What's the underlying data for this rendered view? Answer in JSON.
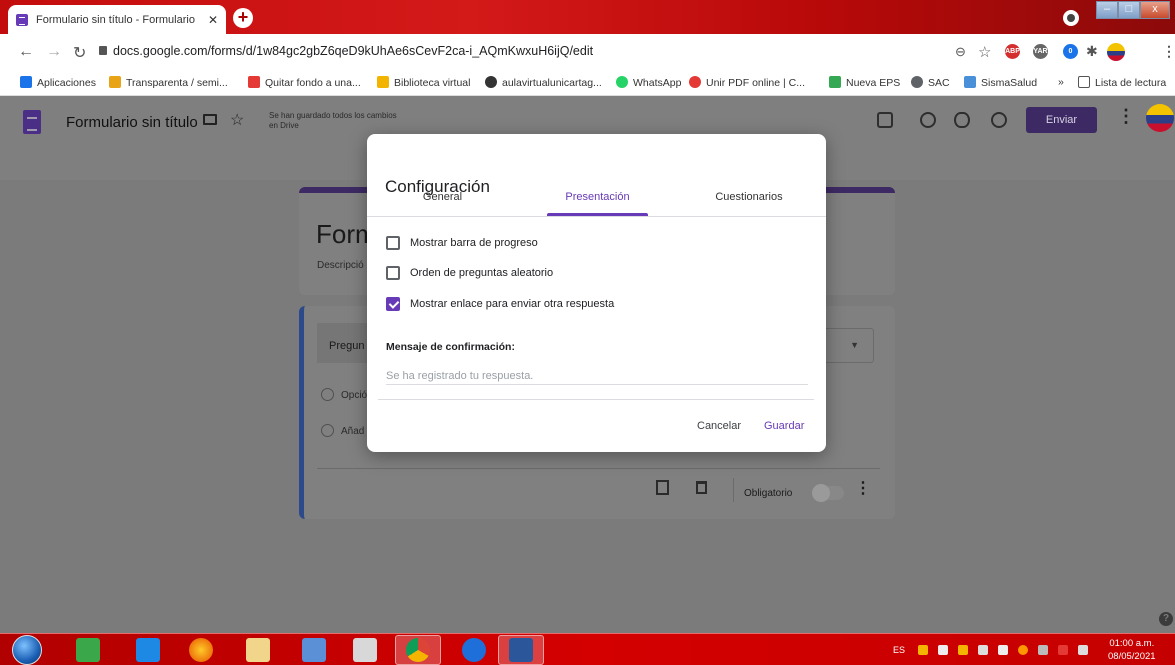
{
  "browser": {
    "tab_title": "Formulario sin título - Formulario",
    "tab_close": "✕",
    "new_tab": "+",
    "url": "docs.google.com/forms/d/1w84gc2gbZ6qeD9kUhAe6sCevF2ca-i_AQmKwxuH6ijQ/edit",
    "window_controls": {
      "minimize": "–",
      "maximize": "□",
      "close": "x"
    },
    "extensions": [
      "ABP",
      "YAR",
      "0"
    ]
  },
  "bookmarks": [
    {
      "label": "Aplicaciones",
      "color": "#1a73e8"
    },
    {
      "label": "Transparenta / semi...",
      "color": "#e8a317"
    },
    {
      "label": "Quitar fondo a una...",
      "color": "#e53935"
    },
    {
      "label": "Biblioteca virtual",
      "color": "#f2b400"
    },
    {
      "label": "aulavirtualunicartag...",
      "color": "#333333"
    },
    {
      "label": "WhatsApp",
      "color": "#25d366"
    },
    {
      "label": "Unir PDF online | C...",
      "color": "#e53935"
    },
    {
      "label": "Nueva EPS",
      "color": "#34a853"
    },
    {
      "label": "SAC",
      "color": "#5f6368"
    },
    {
      "label": "SismaSalud",
      "color": "#4a90d9"
    }
  ],
  "bookmarks_more": "»",
  "reading_list": "Lista de lectura",
  "forms_header": {
    "title": "Formulario sin título",
    "saved_status": "Se han guardado todos los cambios en Drive",
    "send_button": "Enviar"
  },
  "form": {
    "title_partial": "Form",
    "description_partial": "Descripció",
    "question_partial": "Pregun",
    "option_partial": "Opció",
    "add_option_partial": "Añad",
    "required_label": "Obligatorio"
  },
  "dialog": {
    "title": "Configuración",
    "tabs": [
      "General",
      "Presentación",
      "Cuestionarios"
    ],
    "active_tab": "Presentación",
    "options": [
      {
        "label": "Mostrar barra de progreso",
        "checked": false
      },
      {
        "label": "Orden de preguntas aleatorio",
        "checked": false
      },
      {
        "label": "Mostrar enlace para enviar otra respuesta",
        "checked": true
      }
    ],
    "confirmation_label": "Mensaje de confirmación:",
    "confirmation_placeholder": "Se ha registrado tu respuesta.",
    "cancel": "Cancelar",
    "save": "Guardar"
  },
  "taskbar": {
    "language": "ES",
    "time": "01:00 a.m.",
    "date": "08/05/2021"
  },
  "colors": {
    "accent": "#673ab7",
    "taskbar": "#c50000"
  }
}
